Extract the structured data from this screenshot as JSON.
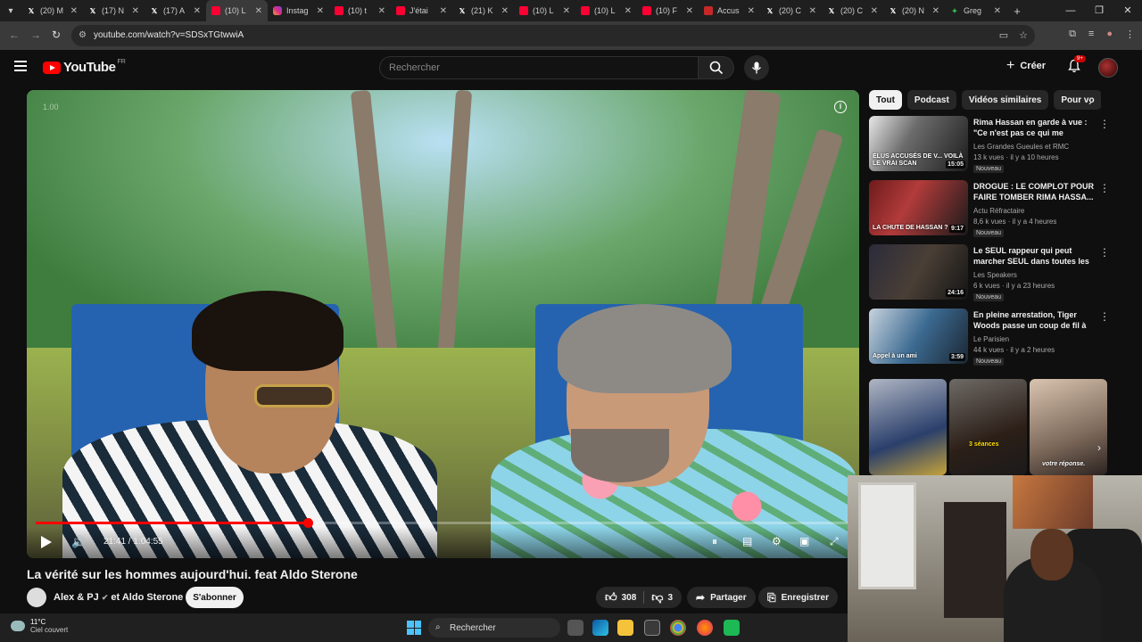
{
  "browser": {
    "tabs": [
      {
        "icon": "x-icon",
        "label": "(20) M"
      },
      {
        "icon": "x-icon",
        "label": "(17) N"
      },
      {
        "icon": "x-icon",
        "label": "(17) A"
      },
      {
        "icon": "youtube-icon",
        "label": "(10) L",
        "active": true
      },
      {
        "icon": "instagram-icon",
        "label": "Instag"
      },
      {
        "icon": "youtube-icon",
        "label": "(10) t"
      },
      {
        "icon": "youtube-icon",
        "label": "J'étai"
      },
      {
        "icon": "x-icon",
        "label": "(21) K"
      },
      {
        "icon": "youtube-icon",
        "label": "(10) L"
      },
      {
        "icon": "youtube-icon",
        "label": "(10) L"
      },
      {
        "icon": "youtube-icon",
        "label": "(10) F"
      },
      {
        "icon": "news-icon",
        "label": "Accus"
      },
      {
        "icon": "x-icon",
        "label": "(20) C"
      },
      {
        "icon": "x-icon",
        "label": "(20) C"
      },
      {
        "icon": "x-icon",
        "label": "(20) N"
      },
      {
        "icon": "greg-icon",
        "label": "Greg"
      }
    ],
    "url": "youtube.com/watch?v=SDSxTGtwwiA"
  },
  "header": {
    "logo_text": "YouTube",
    "country": "FR",
    "search_placeholder": "Rechercher",
    "create_label": "Créer",
    "notif_badge": "9+"
  },
  "player": {
    "speed_label": "1.00",
    "current_time": "21:41",
    "duration": "1:04:55",
    "progress": 0.334
  },
  "video": {
    "title": "La vérité sur les hommes aujourd'hui. feat Aldo Sterone",
    "channel_a": "Alex & PJ",
    "channel_b": "et Aldo Sterone",
    "subscribe_label": "S'abonner",
    "likes": "308",
    "dislikes": "3",
    "share_label": "Partager",
    "save_label": "Enregistrer"
  },
  "sidebar": {
    "chips": [
      "Tout",
      "Podcast",
      "Vidéos similaires",
      "Pour vo"
    ],
    "recommendations": [
      {
        "title": "Rima Hassan en garde à vue : \"Ce n'est pas ce qui me choqu...",
        "channel": "Les Grandes Gueules et RMC",
        "views": "13 k vues · il y a 10 heures",
        "badge": "Nouveau",
        "duration": "15:05",
        "thumb_text": "ÉLUS ACCUSÉS DE V... VOILÀ LE VRAI SCAN"
      },
      {
        "title": "DROGUE : LE COMPLOT POUR FAIRE TOMBER RIMA HASSA...",
        "channel": "Actu Réfractaire",
        "views": "8,6 k vues · il y a 4 heures",
        "badge": "Nouveau",
        "duration": "9:17",
        "thumb_text": "LA CHUTE DE HASSAN ?"
      },
      {
        "title": "Le SEUL rappeur qui peut marcher SEUL dans toutes les ...",
        "channel": "Les Speakers",
        "views": "6 k vues · il y a 23 heures",
        "badge": "Nouveau",
        "duration": "24:16",
        "thumb_text": ""
      },
      {
        "title": "En pleine arrestation, Tiger Woods passe un coup de fil à ...",
        "channel": "Le Parisien",
        "views": "44 k vues · il y a 2 heures",
        "badge": "Nouveau",
        "duration": "3:59",
        "thumb_text": "Appel à un ami"
      }
    ],
    "shorts": [
      {
        "caption": ""
      },
      {
        "caption": "3 séances"
      },
      {
        "caption": "votre réponse."
      }
    ]
  },
  "taskbar": {
    "temp": "11°C",
    "weather": "Ciel couvert",
    "search_label": "Rechercher"
  },
  "colors": {
    "yt_red": "#ff0000",
    "background": "#0f0f0f"
  }
}
